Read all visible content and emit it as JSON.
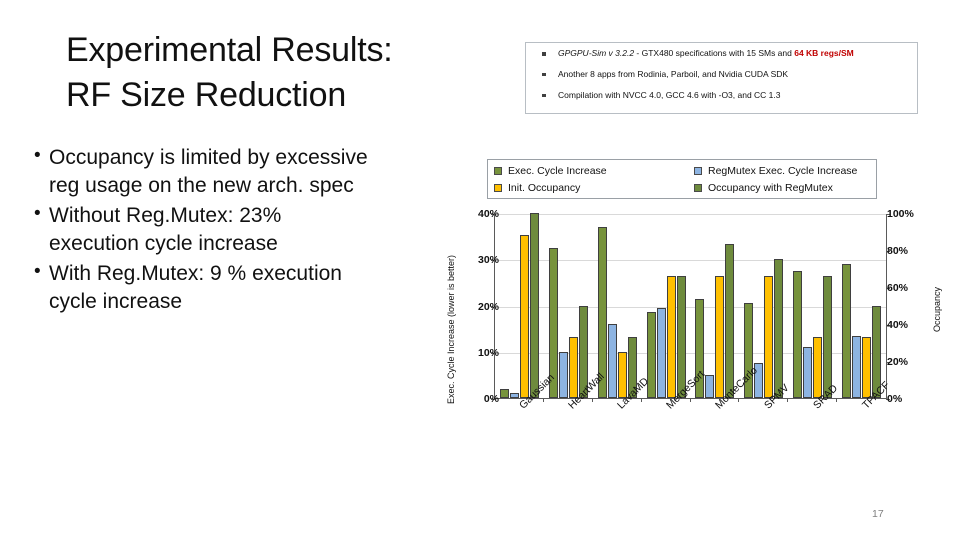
{
  "title": "Experimental Results:\nRF Size Reduction",
  "bullets": [
    "Occupancy is limited by excessive reg usage on the new arch. spec",
    "Without Reg.Mutex: 23% execution cycle increase",
    "With Reg.Mutex: 9 % execution cycle increase"
  ],
  "infobox": {
    "rows": [
      {
        "italic": "GPGPU-Sim v 3.2.2",
        "plain": " - GTX480 specifications with 15 SMs and ",
        "red": "64 KB regs/SM"
      },
      {
        "italic": "",
        "plain": "Another 8 apps from Rodinia, Parboil, and Nvidia CUDA SDK",
        "red": ""
      },
      {
        "italic": "",
        "plain": "Compilation with NVCC 4.0, GCC 4.6 with -O3, and CC 1.3",
        "red": ""
      }
    ]
  },
  "legend": [
    {
      "label": "Exec. Cycle Increase",
      "color": "#77933C"
    },
    {
      "label": "RegMutex Exec. Cycle Increase",
      "color": "#8DB4E2"
    },
    {
      "label": "Init. Occupancy",
      "color": "#FFC000"
    },
    {
      "label": "Occupancy with RegMutex",
      "color": "#6E8B3D"
    }
  ],
  "page_number": "17",
  "chart_data": {
    "type": "bar",
    "title": "",
    "categories": [
      "Gaussian",
      "HeartWall",
      "LavaMD",
      "MergeSort",
      "MonteCarlo",
      "SPMV",
      "SRAD",
      "TPACF"
    ],
    "series": [
      {
        "name": "Exec. Cycle Increase",
        "axis": "left",
        "color": "#77933C",
        "values": [
          2.0,
          32.5,
          37.0,
          18.5,
          21.5,
          20.5,
          27.5,
          29.0
        ]
      },
      {
        "name": "RegMutex Exec. Cycle Increase",
        "axis": "left",
        "color": "#8DB4E2",
        "values": [
          1.0,
          10.0,
          16.0,
          19.5,
          5.0,
          7.5,
          11.0,
          13.5
        ]
      },
      {
        "name": "Init. Occupancy",
        "axis": "right",
        "color": "#FFC000",
        "values": [
          88.0,
          33.0,
          25.0,
          66.0,
          66.0,
          66.0,
          33.0,
          33.0
        ]
      },
      {
        "name": "Occupancy with RegMutex",
        "axis": "right",
        "color": "#6E8B3D",
        "values": [
          100.0,
          50.0,
          33.0,
          66.0,
          83.0,
          75.0,
          66.0,
          50.0
        ]
      }
    ],
    "left_axis": {
      "label": "Exec. Cycle Increase (lower is better)",
      "ticks": [
        "0%",
        "10%",
        "20%",
        "30%",
        "40%"
      ],
      "min": 0,
      "max": 40
    },
    "right_axis": {
      "label": "Occupancy",
      "ticks": [
        "0%",
        "20%",
        "40%",
        "60%",
        "80%",
        "100%"
      ],
      "min": 0,
      "max": 100
    },
    "grid": true,
    "legend_position": "top"
  }
}
